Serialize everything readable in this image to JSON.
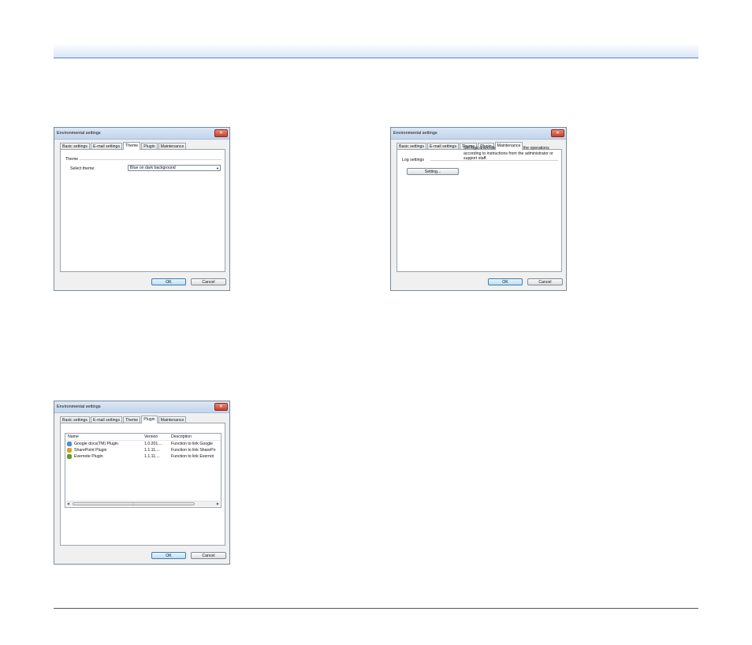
{
  "common": {
    "window_title": "Environmental settings",
    "close_glyph": "✕",
    "tabs": [
      "Basic settings",
      "E-mail settings",
      "Theme",
      "Plugin",
      "Maintenance"
    ],
    "ok_label": "OK",
    "cancel_label": "Cancel"
  },
  "theme_dialog": {
    "active_tab": "Theme",
    "group_label": "Theme",
    "select_label": "Select theme:",
    "select_value": "Blue on dark background",
    "select_arrow": "▼"
  },
  "maintenance_dialog": {
    "active_tab": "Maintenance",
    "group_label": "Log settings",
    "setting_button": "Setting...",
    "description": "Set logs and collect log data. Do the operations according to instructions from the administrator or support staff."
  },
  "plugin_dialog": {
    "active_tab": "Plugin",
    "columns": [
      "Name",
      "Version",
      "Description"
    ],
    "rows": [
      {
        "name": "Google docs(TM) Plugin",
        "version": "1.0.201....",
        "description": "Function to link Google",
        "icon": "google-docs-icon",
        "color": "#4a90d9"
      },
      {
        "name": "SharePoint Plugin",
        "version": "1.1.11....",
        "description": "Function to link SharePo",
        "icon": "sharepoint-icon",
        "color": "#e0a020"
      },
      {
        "name": "Evernote Plugin",
        "version": "1.1.11....",
        "description": "Function to link Evernot",
        "icon": "evernote-icon",
        "color": "#5aa02c"
      }
    ],
    "scroll_left": "◀",
    "scroll_right": "▶",
    "scroll_grip": "⋮"
  }
}
